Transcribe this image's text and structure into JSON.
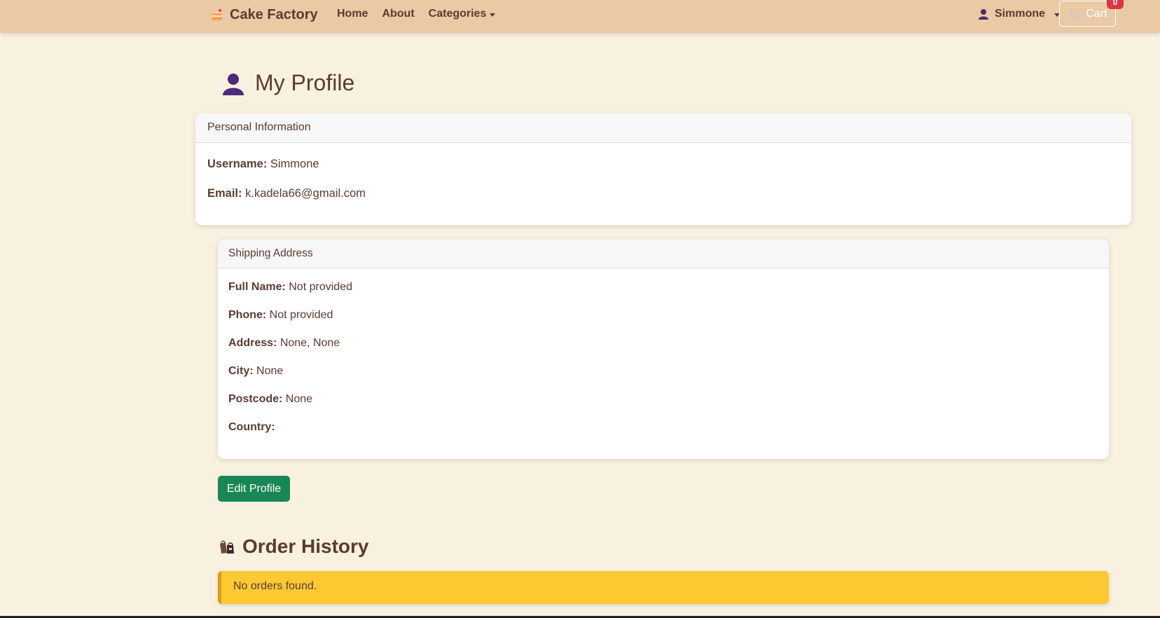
{
  "nav": {
    "brand": "Cake Factory",
    "links": [
      {
        "label": "Home"
      },
      {
        "label": "About"
      },
      {
        "label": "Categories"
      }
    ],
    "user": "Simmone",
    "cart_label": "Cart",
    "cart_count": "0"
  },
  "page": {
    "title": "My Profile"
  },
  "personal": {
    "header": "Personal Information",
    "username_label": "Username:",
    "username": "Simmone",
    "email_label": "Email:",
    "email": "k.kadela66@gmail.com"
  },
  "shipping": {
    "header": "Shipping Address",
    "rows": [
      {
        "label": "Full Name:",
        "value": "Not provided"
      },
      {
        "label": "Phone:",
        "value": "Not provided"
      },
      {
        "label": "Address:",
        "value": "None, None"
      },
      {
        "label": "City:",
        "value": "None"
      },
      {
        "label": "Postcode:",
        "value": "None"
      },
      {
        "label": "Country:",
        "value": ""
      }
    ]
  },
  "edit_button": "Edit Profile",
  "orders": {
    "title": "Order History",
    "empty_message": "No orders found."
  },
  "colors": {
    "background": "#f9f1df",
    "navbar": "#eac9a5",
    "text": "#5a3b32",
    "button_green": "#198754",
    "badge_red": "#dc3545",
    "alert_yellow": "#fcc933"
  }
}
